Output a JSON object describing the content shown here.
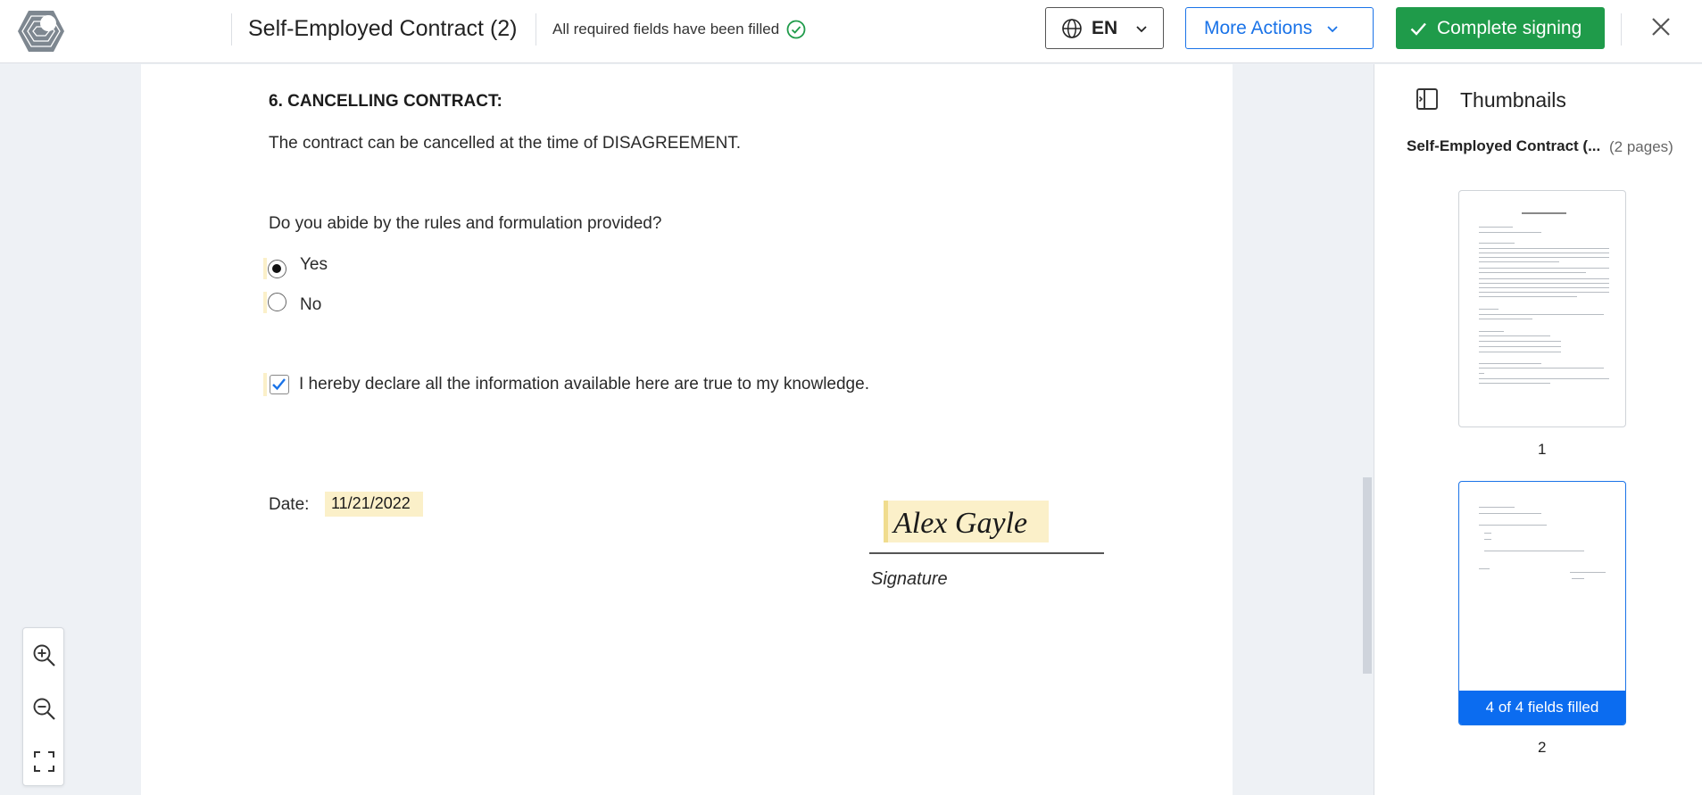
{
  "header": {
    "title": "Self-Employed Contract (2)",
    "status_text": "All required fields have been filled",
    "language": "EN",
    "more_actions_label": "More Actions",
    "complete_label": "Complete signing"
  },
  "document": {
    "section_heading": "6. CANCELLING CONTRACT:",
    "cancel_text": "The contract can be cancelled at the time of DISAGREEMENT.",
    "question": "Do you abide by the rules and formulation provided?",
    "radio_options": [
      {
        "label": "Yes",
        "selected": true
      },
      {
        "label": "No",
        "selected": false
      }
    ],
    "declaration": "I hereby declare all the information available here are true to my knowledge.",
    "declaration_checked": true,
    "date_label": "Date:",
    "date_value": "11/21/2022",
    "signature_value": "Alex Gayle",
    "signature_caption": "Signature"
  },
  "zoom_tools": [
    "zoom-in-icon",
    "zoom-out-icon",
    "fullscreen-icon"
  ],
  "thumbnails": {
    "title": "Thumbnails",
    "doc_name": "Self-Employed Contract (...",
    "page_count": "(2 pages)",
    "pages": [
      {
        "number": "1",
        "selected": false
      },
      {
        "number": "2",
        "selected": true,
        "badge": "4 of 4 fields filled"
      }
    ]
  },
  "colors": {
    "accent_blue": "#1a73e8",
    "complete_green": "#1f9b4a",
    "field_highlight": "#fbf0c9",
    "badge_blue": "#0b6cf0"
  }
}
